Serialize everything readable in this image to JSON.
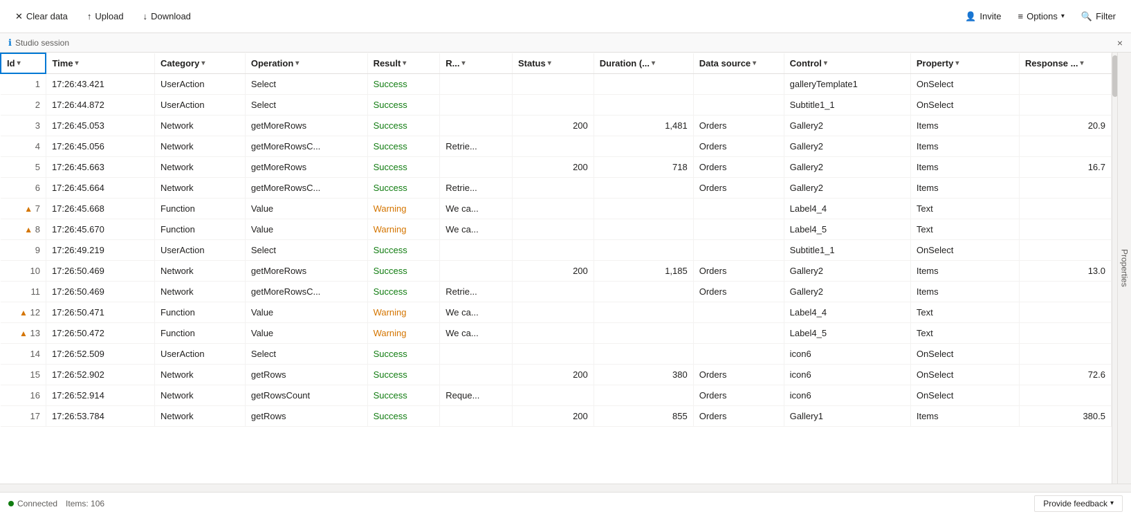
{
  "toolbar": {
    "clear_label": "Clear data",
    "upload_label": "Upload",
    "download_label": "Download",
    "invite_label": "Invite",
    "options_label": "Options",
    "filter_label": "Filter"
  },
  "session": {
    "label": "Studio session",
    "close_label": "×"
  },
  "columns": [
    {
      "key": "id",
      "label": "Id",
      "class": "col-id"
    },
    {
      "key": "time",
      "label": "Time",
      "class": "col-time"
    },
    {
      "key": "category",
      "label": "Category",
      "class": "col-cat"
    },
    {
      "key": "operation",
      "label": "Operation",
      "class": "col-op"
    },
    {
      "key": "result",
      "label": "Result",
      "class": "col-res"
    },
    {
      "key": "r",
      "label": "R...",
      "class": "col-r"
    },
    {
      "key": "status",
      "label": "Status",
      "class": "col-stat"
    },
    {
      "key": "duration",
      "label": "Duration (...",
      "class": "col-dur"
    },
    {
      "key": "datasource",
      "label": "Data source",
      "class": "col-ds"
    },
    {
      "key": "control",
      "label": "Control",
      "class": "col-ctrl"
    },
    {
      "key": "property",
      "label": "Property",
      "class": "col-prop"
    },
    {
      "key": "response",
      "label": "Response ...",
      "class": "col-resp"
    }
  ],
  "rows": [
    {
      "id": 1,
      "warn": false,
      "time": "17:26:43.421",
      "category": "UserAction",
      "operation": "Select",
      "result": "Success",
      "r": "",
      "status": "",
      "duration": "",
      "datasource": "",
      "control": "galleryTemplate1",
      "property": "OnSelect",
      "response": ""
    },
    {
      "id": 2,
      "warn": false,
      "time": "17:26:44.872",
      "category": "UserAction",
      "operation": "Select",
      "result": "Success",
      "r": "",
      "status": "",
      "duration": "",
      "datasource": "",
      "control": "Subtitle1_1",
      "property": "OnSelect",
      "response": ""
    },
    {
      "id": 3,
      "warn": false,
      "time": "17:26:45.053",
      "category": "Network",
      "operation": "getMoreRows",
      "result": "Success",
      "r": "",
      "status": "200",
      "duration": "1,481",
      "datasource": "Orders",
      "control": "Gallery2",
      "property": "Items",
      "response": "20.9"
    },
    {
      "id": 4,
      "warn": false,
      "time": "17:26:45.056",
      "category": "Network",
      "operation": "getMoreRowsC...",
      "result": "Success",
      "r": "Retrie...",
      "status": "",
      "duration": "",
      "datasource": "Orders",
      "control": "Gallery2",
      "property": "Items",
      "response": ""
    },
    {
      "id": 5,
      "warn": false,
      "time": "17:26:45.663",
      "category": "Network",
      "operation": "getMoreRows",
      "result": "Success",
      "r": "",
      "status": "200",
      "duration": "718",
      "datasource": "Orders",
      "control": "Gallery2",
      "property": "Items",
      "response": "16.7"
    },
    {
      "id": 6,
      "warn": false,
      "time": "17:26:45.664",
      "category": "Network",
      "operation": "getMoreRowsC...",
      "result": "Success",
      "r": "Retrie...",
      "status": "",
      "duration": "",
      "datasource": "Orders",
      "control": "Gallery2",
      "property": "Items",
      "response": ""
    },
    {
      "id": 7,
      "warn": true,
      "time": "17:26:45.668",
      "category": "Function",
      "operation": "Value",
      "result": "Warning",
      "r": "We ca...",
      "status": "",
      "duration": "",
      "datasource": "",
      "control": "Label4_4",
      "property": "Text",
      "response": ""
    },
    {
      "id": 8,
      "warn": true,
      "time": "17:26:45.670",
      "category": "Function",
      "operation": "Value",
      "result": "Warning",
      "r": "We ca...",
      "status": "",
      "duration": "",
      "datasource": "",
      "control": "Label4_5",
      "property": "Text",
      "response": ""
    },
    {
      "id": 9,
      "warn": false,
      "time": "17:26:49.219",
      "category": "UserAction",
      "operation": "Select",
      "result": "Success",
      "r": "",
      "status": "",
      "duration": "",
      "datasource": "",
      "control": "Subtitle1_1",
      "property": "OnSelect",
      "response": ""
    },
    {
      "id": 10,
      "warn": false,
      "time": "17:26:50.469",
      "category": "Network",
      "operation": "getMoreRows",
      "result": "Success",
      "r": "",
      "status": "200",
      "duration": "1,185",
      "datasource": "Orders",
      "control": "Gallery2",
      "property": "Items",
      "response": "13.0"
    },
    {
      "id": 11,
      "warn": false,
      "time": "17:26:50.469",
      "category": "Network",
      "operation": "getMoreRowsC...",
      "result": "Success",
      "r": "Retrie...",
      "status": "",
      "duration": "",
      "datasource": "Orders",
      "control": "Gallery2",
      "property": "Items",
      "response": ""
    },
    {
      "id": 12,
      "warn": true,
      "time": "17:26:50.471",
      "category": "Function",
      "operation": "Value",
      "result": "Warning",
      "r": "We ca...",
      "status": "",
      "duration": "",
      "datasource": "",
      "control": "Label4_4",
      "property": "Text",
      "response": ""
    },
    {
      "id": 13,
      "warn": true,
      "time": "17:26:50.472",
      "category": "Function",
      "operation": "Value",
      "result": "Warning",
      "r": "We ca...",
      "status": "",
      "duration": "",
      "datasource": "",
      "control": "Label4_5",
      "property": "Text",
      "response": ""
    },
    {
      "id": 14,
      "warn": false,
      "time": "17:26:52.509",
      "category": "UserAction",
      "operation": "Select",
      "result": "Success",
      "r": "",
      "status": "",
      "duration": "",
      "datasource": "",
      "control": "icon6",
      "property": "OnSelect",
      "response": ""
    },
    {
      "id": 15,
      "warn": false,
      "time": "17:26:52.902",
      "category": "Network",
      "operation": "getRows",
      "result": "Success",
      "r": "",
      "status": "200",
      "duration": "380",
      "datasource": "Orders",
      "control": "icon6",
      "property": "OnSelect",
      "response": "72.6"
    },
    {
      "id": 16,
      "warn": false,
      "time": "17:26:52.914",
      "category": "Network",
      "operation": "getRowsCount",
      "result": "Success",
      "r": "Reque...",
      "status": "",
      "duration": "",
      "datasource": "Orders",
      "control": "icon6",
      "property": "OnSelect",
      "response": ""
    },
    {
      "id": 17,
      "warn": false,
      "time": "17:26:53.784",
      "category": "Network",
      "operation": "getRows",
      "result": "Success",
      "r": "",
      "status": "200",
      "duration": "855",
      "datasource": "Orders",
      "control": "Gallery1",
      "property": "Items",
      "response": "380.5"
    }
  ],
  "status": {
    "connected": "Connected",
    "items": "Items: 106"
  },
  "feedback": {
    "label": "Provide feedback"
  },
  "right_panel": {
    "label": "Properties"
  }
}
